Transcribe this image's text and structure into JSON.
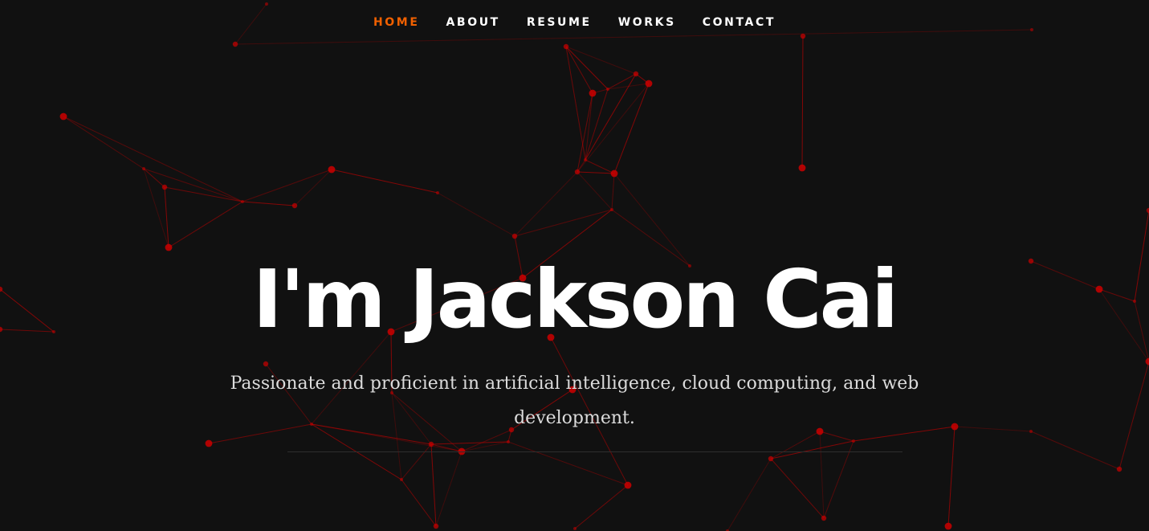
{
  "nav": {
    "items": [
      {
        "label": "HOME",
        "active": true
      },
      {
        "label": "ABOUT",
        "active": false
      },
      {
        "label": "RESUME",
        "active": false
      },
      {
        "label": "WORKS",
        "active": false
      },
      {
        "label": "CONTACT",
        "active": false
      }
    ]
  },
  "hero": {
    "headline": "I'm Jackson Cai",
    "subline": "Passionate and proficient in artificial intelligence, cloud computing, and web development."
  },
  "colors": {
    "background": "#111111",
    "accent": "#f06000",
    "particles": "#cc0000"
  }
}
